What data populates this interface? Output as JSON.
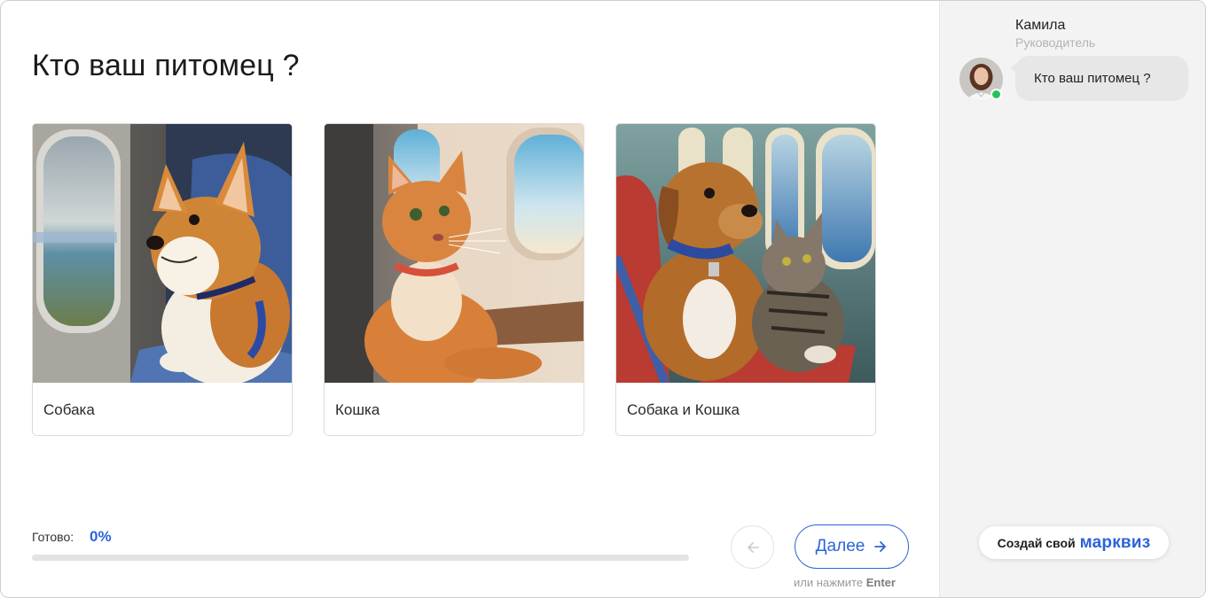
{
  "question": {
    "title": "Кто ваш питомец ?"
  },
  "options": [
    {
      "label": "Собака",
      "image": "corgi-on-airplane-photo"
    },
    {
      "label": "Кошка",
      "image": "cat-on-airplane-photo"
    },
    {
      "label": "Собака и Кошка",
      "image": "dog-and-cat-on-airplane-photo"
    }
  ],
  "progress": {
    "label": "Готово:",
    "value_text": "0%",
    "fraction": 0
  },
  "nav": {
    "back_icon": "arrow-left-icon",
    "next_label": "Далее",
    "next_icon": "arrow-right-icon",
    "hint_prefix": "или нажмите",
    "hint_key": "Enter"
  },
  "sidebar": {
    "agent_name": "Камила",
    "agent_role": "Руководитель",
    "message": "Кто ваш питомец ?",
    "online": true,
    "cta_prefix": "Создай свой",
    "cta_brand": "марквиз"
  },
  "colors": {
    "accent": "#2b63d9",
    "online": "#25c35a",
    "sidebar_bg": "#f3f3f3"
  }
}
